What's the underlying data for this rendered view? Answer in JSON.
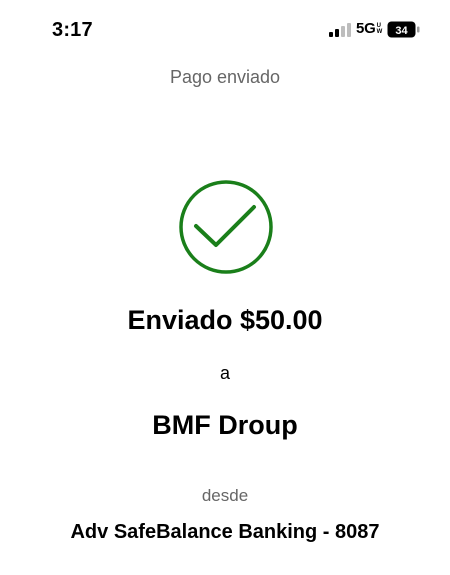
{
  "status_bar": {
    "time": "3:17",
    "network": "5G",
    "network_sup_top": "U",
    "network_sup_bottom": "W",
    "battery": "34"
  },
  "title": "Pago enviado",
  "confirmation": {
    "sent_text": "Enviado $50.00",
    "to_label": "a",
    "recipient": "BMF Droup",
    "from_label": "desde",
    "account": "Adv SafeBalance Banking - 8087"
  },
  "colors": {
    "success_green": "#1a7f1a",
    "muted_text": "#666666"
  },
  "icons": {
    "status": [
      "signal-bars-icon",
      "battery-icon"
    ],
    "main": "checkmark-circle-icon"
  }
}
